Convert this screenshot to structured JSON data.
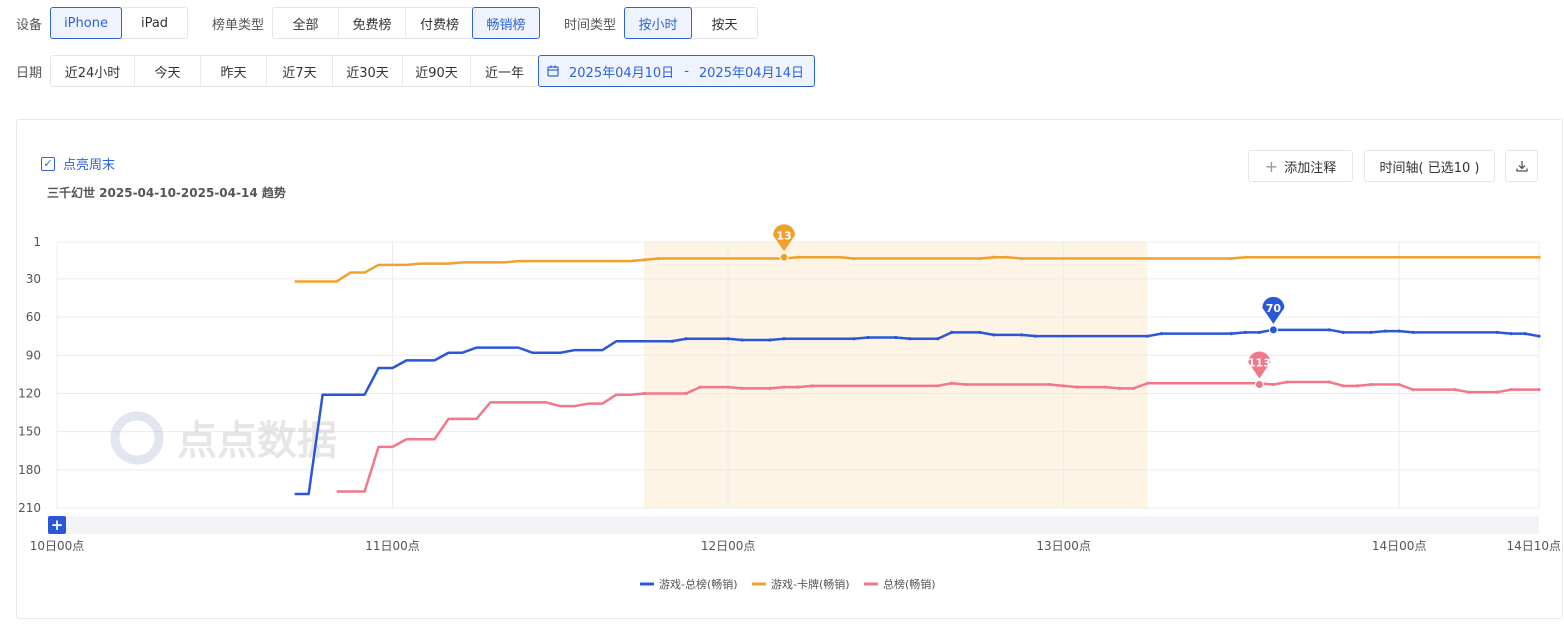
{
  "filters": {
    "device": {
      "label": "设备",
      "options": [
        "iPhone",
        "iPad"
      ],
      "selected": "iPhone"
    },
    "list_type": {
      "label": "榜单类型",
      "options": [
        "全部",
        "免费榜",
        "付费榜",
        "畅销榜"
      ],
      "selected": "畅销榜"
    },
    "time_type": {
      "label": "时间类型",
      "options": [
        "按小时",
        "按天"
      ],
      "selected": "按小时"
    },
    "date": {
      "label": "日期",
      "presets": [
        "近24小时",
        "今天",
        "昨天",
        "近7天",
        "近30天",
        "近90天",
        "近一年"
      ],
      "range_start": "2025年04月10日",
      "range_sep": "-",
      "range_end": "2025年04月14日"
    }
  },
  "panel": {
    "weekend_toggle": "点亮周末",
    "subtitle": "三千幻世 2025-04-10-2025-04-14 趋势",
    "add_note": "添加注释",
    "timeline": "时间轴( 已选10 )",
    "watermark": "点点数据"
  },
  "colors": {
    "accent": "#2d63d9",
    "blue": "#2a57d8",
    "orange": "#f0a12d",
    "pink": "#f07888",
    "weekend": "#fdf4e6"
  },
  "chart_data": {
    "type": "line",
    "title": "",
    "ylabel": "",
    "y_inverted": true,
    "ylim": [
      1,
      210
    ],
    "y_ticks": [
      1,
      30,
      60,
      90,
      120,
      150,
      180,
      210
    ],
    "x_unit": "hour",
    "xlim": [
      "2025-04-10 00:00",
      "2025-04-14 10:00"
    ],
    "x_ticks": [
      {
        "x": "2025-04-10 00:00",
        "label": "10日00点"
      },
      {
        "x": "2025-04-11 00:00",
        "label": "11日00点"
      },
      {
        "x": "2025-04-12 00:00",
        "label": "12日00点"
      },
      {
        "x": "2025-04-13 00:00",
        "label": "13日00点"
      },
      {
        "x": "2025-04-14 00:00",
        "label": "14日00点"
      },
      {
        "x": "2025-04-14 10:00",
        "label": "14日10点"
      }
    ],
    "highlight_range": [
      "2025-04-11 18:00",
      "2025-04-13 06:00"
    ],
    "legend_position": "bottom-center",
    "series": [
      {
        "name": "游戏-总榜(畅销)",
        "color": "#2a57d8",
        "points": [
          [
            "2025-04-10 17:00",
            199
          ],
          [
            "2025-04-10 18:00",
            199
          ],
          [
            "2025-04-10 19:00",
            121
          ],
          [
            "2025-04-10 22:00",
            121
          ],
          [
            "2025-04-10 23:00",
            100
          ],
          [
            "2025-04-11 00:00",
            100
          ],
          [
            "2025-04-11 01:00",
            94
          ],
          [
            "2025-04-11 02:00",
            94
          ],
          [
            "2025-04-11 03:00",
            94
          ],
          [
            "2025-04-11 04:00",
            88
          ],
          [
            "2025-04-11 05:00",
            88
          ],
          [
            "2025-04-11 06:00",
            84
          ],
          [
            "2025-04-11 09:00",
            84
          ],
          [
            "2025-04-11 10:00",
            88
          ],
          [
            "2025-04-11 12:00",
            88
          ],
          [
            "2025-04-11 13:00",
            86
          ],
          [
            "2025-04-11 15:00",
            86
          ],
          [
            "2025-04-11 16:00",
            79
          ],
          [
            "2025-04-11 20:00",
            79
          ],
          [
            "2025-04-11 21:00",
            77
          ],
          [
            "2025-04-12 00:00",
            77
          ],
          [
            "2025-04-12 01:00",
            78
          ],
          [
            "2025-04-12 03:00",
            78
          ],
          [
            "2025-04-12 04:00",
            77
          ],
          [
            "2025-04-12 09:00",
            77
          ],
          [
            "2025-04-12 10:00",
            76
          ],
          [
            "2025-04-12 12:00",
            76
          ],
          [
            "2025-04-12 13:00",
            77
          ],
          [
            "2025-04-12 15:00",
            77
          ],
          [
            "2025-04-12 16:00",
            72
          ],
          [
            "2025-04-12 18:00",
            72
          ],
          [
            "2025-04-12 19:00",
            74
          ],
          [
            "2025-04-12 21:00",
            74
          ],
          [
            "2025-04-12 22:00",
            75
          ],
          [
            "2025-04-13 06:00",
            75
          ],
          [
            "2025-04-13 07:00",
            73
          ],
          [
            "2025-04-13 12:00",
            73
          ],
          [
            "2025-04-13 13:00",
            72
          ],
          [
            "2025-04-13 14:00",
            72
          ],
          [
            "2025-04-13 15:00",
            70
          ],
          [
            "2025-04-13 19:00",
            70
          ],
          [
            "2025-04-13 20:00",
            72
          ],
          [
            "2025-04-13 22:00",
            72
          ],
          [
            "2025-04-13 23:00",
            71
          ],
          [
            "2025-04-14 00:00",
            71
          ],
          [
            "2025-04-14 01:00",
            72
          ],
          [
            "2025-04-14 07:00",
            72
          ],
          [
            "2025-04-14 08:00",
            73
          ],
          [
            "2025-04-14 09:00",
            73
          ],
          [
            "2025-04-14 10:00",
            75
          ]
        ]
      },
      {
        "name": "游戏-卡牌(畅销)",
        "color": "#f0a12d",
        "points": [
          [
            "2025-04-10 17:00",
            32
          ],
          [
            "2025-04-10 20:00",
            32
          ],
          [
            "2025-04-10 21:00",
            25
          ],
          [
            "2025-04-10 22:00",
            25
          ],
          [
            "2025-04-10 23:00",
            19
          ],
          [
            "2025-04-11 01:00",
            19
          ],
          [
            "2025-04-11 02:00",
            18
          ],
          [
            "2025-04-11 04:00",
            18
          ],
          [
            "2025-04-11 05:00",
            17
          ],
          [
            "2025-04-11 08:00",
            17
          ],
          [
            "2025-04-11 09:00",
            16
          ],
          [
            "2025-04-11 17:00",
            16
          ],
          [
            "2025-04-11 18:00",
            15
          ],
          [
            "2025-04-11 19:00",
            14
          ],
          [
            "2025-04-12 04:00",
            14
          ],
          [
            "2025-04-12 05:00",
            13
          ],
          [
            "2025-04-12 08:00",
            13
          ],
          [
            "2025-04-12 09:00",
            14
          ],
          [
            "2025-04-12 18:00",
            14
          ],
          [
            "2025-04-12 19:00",
            13
          ],
          [
            "2025-04-12 20:00",
            13
          ],
          [
            "2025-04-12 21:00",
            14
          ],
          [
            "2025-04-13 12:00",
            14
          ],
          [
            "2025-04-13 13:00",
            13
          ],
          [
            "2025-04-14 10:00",
            13
          ]
        ]
      },
      {
        "name": "总榜(畅销)",
        "color": "#f07888",
        "points": [
          [
            "2025-04-10 20:00",
            197
          ],
          [
            "2025-04-10 22:00",
            197
          ],
          [
            "2025-04-10 23:00",
            162
          ],
          [
            "2025-04-11 00:00",
            162
          ],
          [
            "2025-04-11 01:00",
            156
          ],
          [
            "2025-04-11 03:00",
            156
          ],
          [
            "2025-04-11 04:00",
            140
          ],
          [
            "2025-04-11 06:00",
            140
          ],
          [
            "2025-04-11 07:00",
            127
          ],
          [
            "2025-04-11 11:00",
            127
          ],
          [
            "2025-04-11 12:00",
            130
          ],
          [
            "2025-04-11 13:00",
            130
          ],
          [
            "2025-04-11 14:00",
            128
          ],
          [
            "2025-04-11 15:00",
            128
          ],
          [
            "2025-04-11 16:00",
            121
          ],
          [
            "2025-04-11 17:00",
            121
          ],
          [
            "2025-04-11 18:00",
            120
          ],
          [
            "2025-04-11 21:00",
            120
          ],
          [
            "2025-04-11 22:00",
            115
          ],
          [
            "2025-04-12 00:00",
            115
          ],
          [
            "2025-04-12 01:00",
            116
          ],
          [
            "2025-04-12 03:00",
            116
          ],
          [
            "2025-04-12 04:00",
            115
          ],
          [
            "2025-04-12 05:00",
            115
          ],
          [
            "2025-04-12 06:00",
            114
          ],
          [
            "2025-04-12 15:00",
            114
          ],
          [
            "2025-04-12 16:00",
            112
          ],
          [
            "2025-04-12 17:00",
            113
          ],
          [
            "2025-04-12 23:00",
            113
          ],
          [
            "2025-04-13 00:00",
            114
          ],
          [
            "2025-04-13 01:00",
            115
          ],
          [
            "2025-04-13 03:00",
            115
          ],
          [
            "2025-04-13 04:00",
            116
          ],
          [
            "2025-04-13 05:00",
            116
          ],
          [
            "2025-04-13 06:00",
            112
          ],
          [
            "2025-04-13 14:00",
            112
          ],
          [
            "2025-04-13 15:00",
            113
          ],
          [
            "2025-04-13 16:00",
            111
          ],
          [
            "2025-04-13 19:00",
            111
          ],
          [
            "2025-04-13 20:00",
            114
          ],
          [
            "2025-04-13 21:00",
            114
          ],
          [
            "2025-04-13 22:00",
            113
          ],
          [
            "2025-04-14 00:00",
            113
          ],
          [
            "2025-04-14 01:00",
            117
          ],
          [
            "2025-04-14 04:00",
            117
          ],
          [
            "2025-04-14 05:00",
            119
          ],
          [
            "2025-04-14 07:00",
            119
          ],
          [
            "2025-04-14 08:00",
            117
          ],
          [
            "2025-04-14 10:00",
            117
          ]
        ]
      }
    ],
    "markers": [
      {
        "series": 1,
        "x": "2025-04-12 04:00",
        "y": 13,
        "label": "13"
      },
      {
        "series": 0,
        "x": "2025-04-13 15:00",
        "y": 70,
        "label": "70"
      },
      {
        "series": 2,
        "x": "2025-04-13 14:00",
        "y": 113,
        "label": "113"
      }
    ]
  }
}
